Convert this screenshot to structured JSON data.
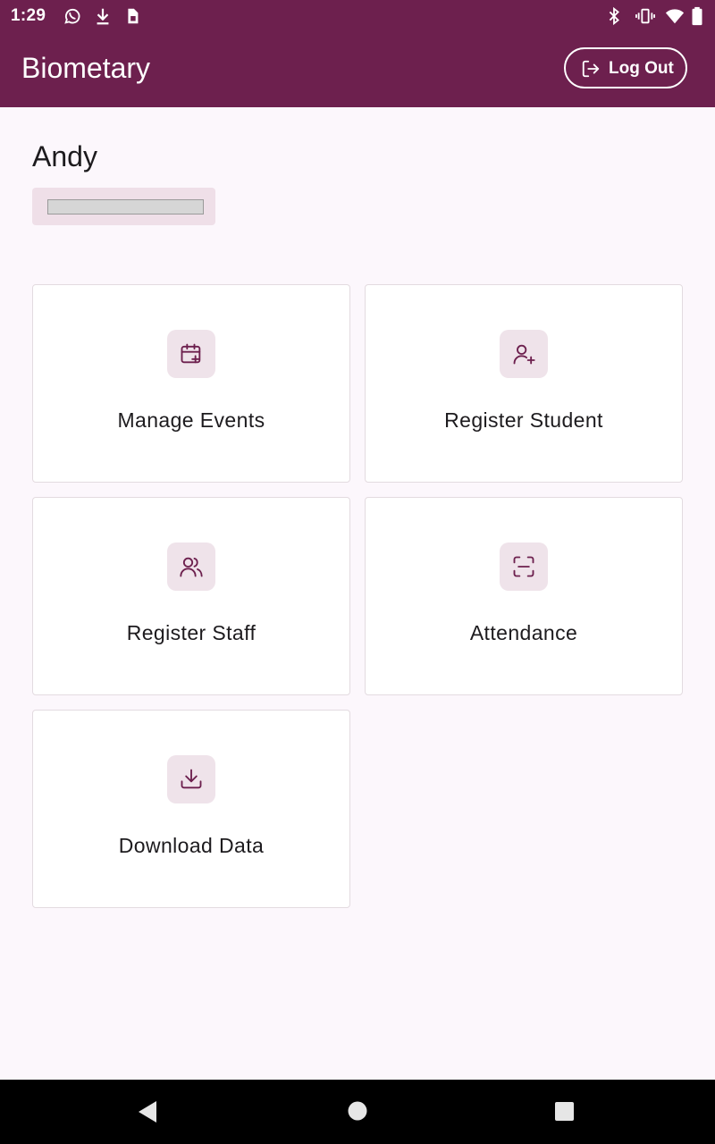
{
  "status_bar": {
    "time": "1:29",
    "left_icons": [
      "whatsapp-icon",
      "download-icon",
      "sim-icon"
    ],
    "right_icons": [
      "bluetooth-icon",
      "vibrate-icon",
      "wifi-icon",
      "battery-icon"
    ]
  },
  "app_bar": {
    "title": "Biometary",
    "logout_label": "Log Out"
  },
  "user": {
    "name": "Andy",
    "progress_fraction": 0
  },
  "menu": {
    "items": [
      {
        "label": "Manage Events",
        "icon": "calendar-plus-icon"
      },
      {
        "label": "Register Student",
        "icon": "user-plus-icon"
      },
      {
        "label": "Register Staff",
        "icon": "users-icon"
      },
      {
        "label": "Attendance",
        "icon": "scan-icon"
      },
      {
        "label": "Download Data",
        "icon": "download-tray-icon"
      }
    ]
  },
  "nav_bar": {
    "buttons": [
      "back-icon",
      "home-icon",
      "recents-icon"
    ]
  },
  "colors": {
    "primary": "#6d204e",
    "background": "#fcf7fc",
    "icon_tile": "#efe3ea"
  }
}
